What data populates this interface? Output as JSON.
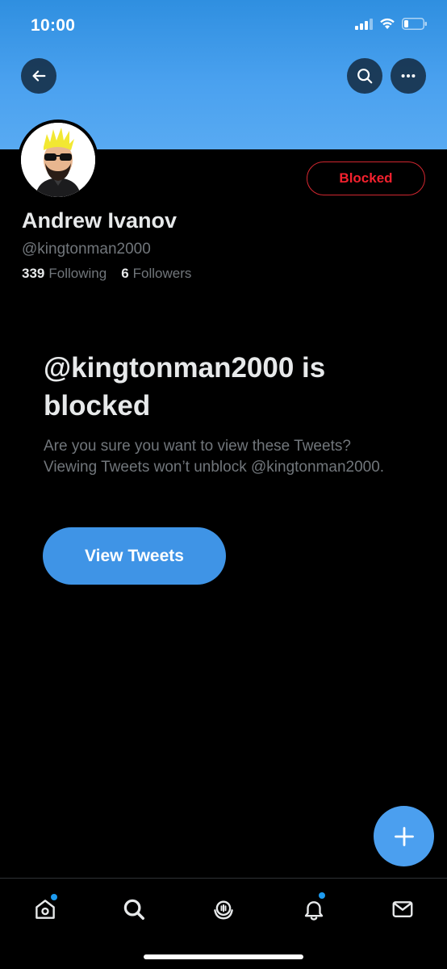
{
  "status_bar": {
    "time": "10:00"
  },
  "profile": {
    "display_name": "Andrew Ivanov",
    "handle": "@kingtonman2000",
    "following_count": "339",
    "following_label": "Following",
    "followers_count": "6",
    "followers_label": "Followers",
    "blocked_button_label": "Blocked"
  },
  "blocked_notice": {
    "title": "@kingtonman2000 is blocked",
    "description": "Are you sure you want to view these Tweets? Viewing Tweets won’t unblock @kingtonman2000.",
    "view_button_label": "View Tweets"
  },
  "header_icons": [
    "back-arrow-icon",
    "search-icon",
    "more-icon"
  ],
  "tab_bar": {
    "items": [
      {
        "name": "home",
        "icon": "home-icon",
        "has_dot": true
      },
      {
        "name": "search",
        "icon": "search-icon",
        "has_dot": false
      },
      {
        "name": "spaces",
        "icon": "spaces-icon",
        "has_dot": false
      },
      {
        "name": "notifications",
        "icon": "bell-icon",
        "has_dot": true
      },
      {
        "name": "messages",
        "icon": "mail-icon",
        "has_dot": false
      }
    ]
  },
  "colors": {
    "accent": "#1d9bf0",
    "blocked_red": "#f4212e",
    "background": "#000000",
    "secondary_text": "#71767b"
  }
}
